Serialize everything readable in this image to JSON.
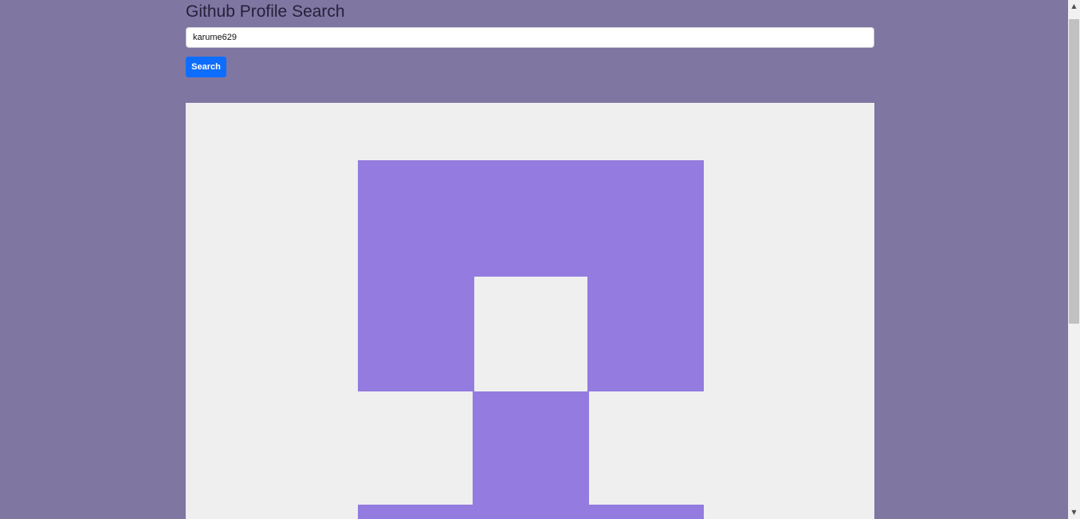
{
  "header": {
    "title": "Github Profile Search"
  },
  "search": {
    "value": "karume629",
    "button_label": "Search"
  },
  "colors": {
    "background": "#7f76a2",
    "avatar_background": "#efeff0",
    "avatar_foreground": "#937bdf",
    "button": "#0d6efd"
  },
  "icons": {
    "scroll_up": "▲",
    "scroll_down": "▼"
  }
}
